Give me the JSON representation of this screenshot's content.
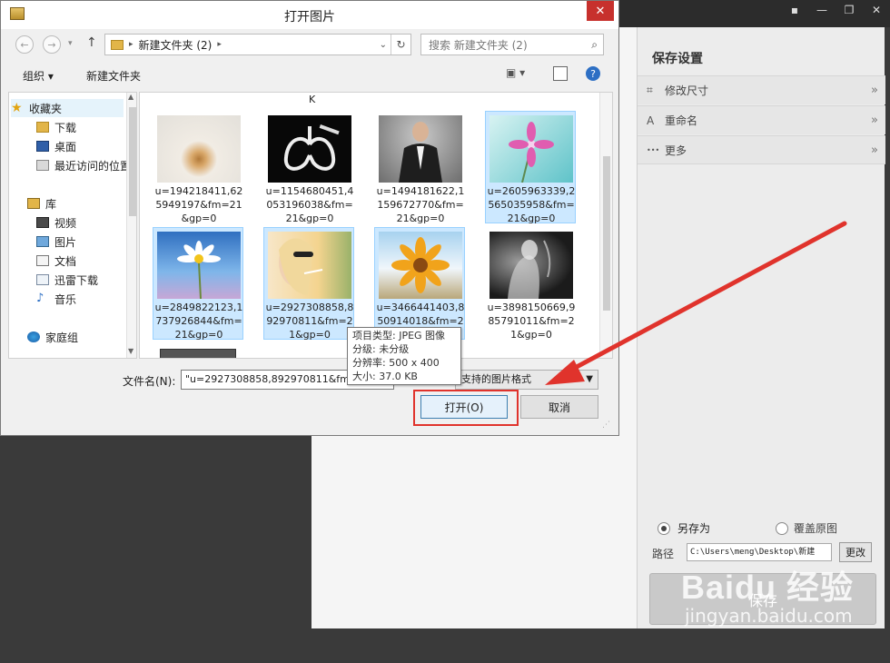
{
  "app": {
    "panel": {
      "title": "保存设置",
      "rows": [
        {
          "icon": "crop-icon",
          "glyph": "⌗",
          "label": "修改尺寸"
        },
        {
          "icon": "rename-icon",
          "glyph": "A",
          "label": "重命名"
        },
        {
          "icon": "more-dots-icon",
          "glyph": "•••",
          "label": "更多"
        }
      ],
      "chevron": "»",
      "save_as_label": "另存为",
      "overwrite_label": "覆盖原图",
      "path_label": "路径",
      "path_value": "C:\\Users\\meng\\Desktop\\新建",
      "change_label": "更改",
      "big_save_label": "保存"
    }
  },
  "dialog": {
    "title": "打开图片",
    "close": "✕",
    "address": {
      "sep": "▸",
      "folder": "新建文件夹 (2)",
      "refresh": "↻",
      "dropdown": "⌄"
    },
    "search_placeholder": "搜索 新建文件夹 (2)",
    "search_icon": "⌕",
    "toolbar": {
      "organize": "组织 ▾",
      "new_folder": "新建文件夹",
      "view": "▣ ▾",
      "help": "?"
    },
    "nav": [
      {
        "label": "收藏夹",
        "icon": "star-icon"
      },
      {
        "label": "下载",
        "icon": "download-folder-icon"
      },
      {
        "label": "桌面",
        "icon": "desktop-icon"
      },
      {
        "label": "最近访问的位置",
        "icon": "recent-places-icon"
      },
      {
        "label": "库",
        "icon": "library-icon"
      },
      {
        "label": "视频",
        "icon": "video-icon"
      },
      {
        "label": "图片",
        "icon": "pictures-icon"
      },
      {
        "label": "文档",
        "icon": "documents-icon"
      },
      {
        "label": "迅雷下载",
        "icon": "thunder-download-icon"
      },
      {
        "label": "音乐",
        "icon": "music-icon"
      },
      {
        "label": "家庭组",
        "icon": "homegroup-icon"
      }
    ],
    "partial_label": "K",
    "files": [
      {
        "name": "u=194218411,625949197&fm=21&gp=0",
        "selected": false
      },
      {
        "name": "u=1154680451,4053196038&fm=21&gp=0",
        "selected": false
      },
      {
        "name": "u=1494181622,1159672770&fm=21&gp=0",
        "selected": false
      },
      {
        "name": "u=2605963339,2565035958&fm=21&gp=0",
        "selected": true
      },
      {
        "name": "u=2849822123,1737926844&fm=21&gp=0",
        "selected": true
      },
      {
        "name": "u=2927308858,892970811&fm=21&gp=0",
        "selected": true
      },
      {
        "name": "u=3466441403,850914018&fm=21&gp=0",
        "selected": true
      },
      {
        "name": "u=3898150669,985791011&fm=21&gp=0",
        "selected": false
      }
    ],
    "filename_label": "文件名(N):",
    "filename_value": "\"u=2927308858,892970811&fm=21",
    "filter_label": "支持的图片格式",
    "open_label": "打开(O)",
    "cancel_label": "取消",
    "tooltip": {
      "line1": "项目类型: JPEG 图像",
      "line2": "分级: 未分级",
      "line3": "分辨率: 500 x 400",
      "line4": "大小: 37.0 KB"
    }
  },
  "watermark": {
    "brand": "Baidu 经验",
    "url": "jingyan.baidu.com"
  },
  "colors": {
    "highlight_red": "#e0332c",
    "selection": "#cce8ff"
  }
}
